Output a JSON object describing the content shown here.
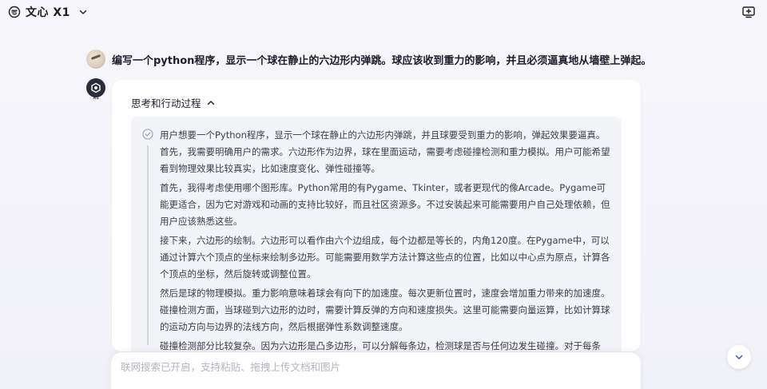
{
  "header": {
    "title": "文心 X1",
    "logo_icon": "wenxin-logo-icon",
    "dropdown_icon": "chevron-down-icon",
    "new_chat_icon": "new-chat-icon"
  },
  "conversation": {
    "user_message": "编写一个python程序，显示一个球在静止的六边形内弹跳。球应该收到重力的影响，并且必须逼真地从墙壁上弹起。",
    "bot_tag": "X1",
    "thinking": {
      "header": "思考和行动过程",
      "paragraphs": [
        "用户想要一个Python程序，显示一个球在静止的六边形内弹跳，并且球要受到重力的影响，弹起效果要逼真。首先，我需要明确用户的需求。六边形作为边界，球在里面运动，需要考虑碰撞检测和重力模拟。用户可能希望看到物理效果比较真实，比如速度变化、弹性碰撞等。",
        "首先，我得考虑使用哪个图形库。Python常用的有Pygame、Tkinter，或者更现代的像Arcade。Pygame可能更适合，因为它对游戏和动画的支持比较好，而且社区资源多。不过安装起来可能需要用户自己处理依赖，但用户应该熟悉这些。",
        "接下来，六边形的绘制。六边形可以看作由六个边组成，每个边都是等长的，内角120度。在Pygame中，可以通过计算六个顶点的坐标来绘制多边形。可能需要用数学方法计算这些点的位置，比如以中心点为原点，计算各个顶点的坐标，然后旋转或调整位置。",
        "然后是球的物理模拟。重力影响意味着球会有向下的加速度。每次更新位置时，速度会增加重力带来的加速度。碰撞检测方面，当球碰到六边形的边时，需要计算反弹的方向和速度损失。这里可能需要向量运算，比如计算球的运动方向与边界的法线方向，然后根据弹性系数调整速度。",
        "碰撞检测部分比较复杂。因为六边形是凸多边形，可以分解每条边，检测球是否与任何边发生碰撞。对于每条"
      ]
    }
  },
  "composer": {
    "placeholder": "联网搜索已开启，支持粘贴、拖拽上传文档和图片"
  },
  "colors": {
    "background": "#f4f4fa",
    "card": "#ffffff",
    "thinking_bg": "#f3f4f8",
    "text_primary": "#1d1d2c",
    "text_secondary": "#3c3c4a",
    "placeholder": "#b3b4be"
  }
}
